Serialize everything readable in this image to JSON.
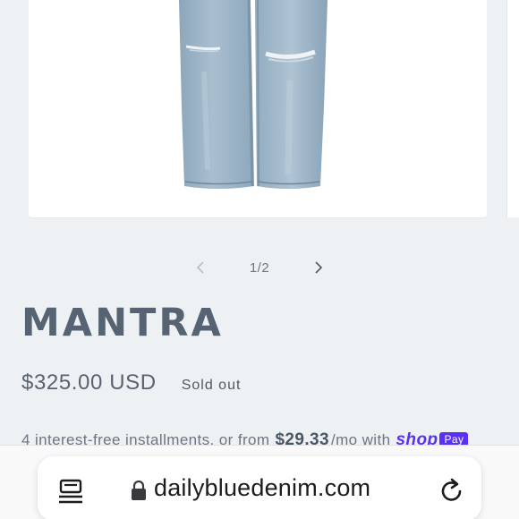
{
  "product_gallery": {
    "image_alt": "MANTRA jeans",
    "counter": "1/2",
    "prev_icon": "chevron-left-icon",
    "next_icon": "chevron-right-icon"
  },
  "product": {
    "title": "MANTRA",
    "price": "$325.00 USD",
    "badge": "Sold out"
  },
  "installments": {
    "prefix": "4 interest-free installments, or from",
    "amount": "$29.33",
    "suffix": "/mo with",
    "brand": "shop",
    "brand_badge": "Pay",
    "brand_color": "#5a31f4"
  },
  "browser": {
    "url": "dailybluedenim.com",
    "reader_icon": "reader-view-icon",
    "lock_icon": "lock-icon",
    "reload_icon": "reload-icon"
  },
  "colors": {
    "background": "#eef1f4",
    "title": "#566372",
    "denim": "#9db4c6"
  }
}
